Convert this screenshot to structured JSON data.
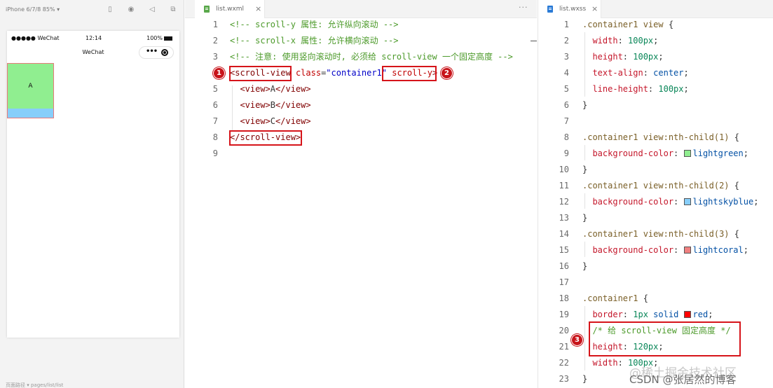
{
  "simulator": {
    "device_label": "iPhone 6/7/8 85% ▾",
    "status": {
      "carrier": "●●●●● WeChat",
      "time": "12:14",
      "battery": "100%"
    },
    "navbar_title": "WeChat",
    "views": [
      {
        "label": "A",
        "color": "#90ee90"
      },
      {
        "label": "",
        "color": "#87cefa"
      }
    ],
    "bottom_text": "页面路径 ▾    pages/list/list"
  },
  "wxml_editor": {
    "tab_label": "list.wxml",
    "lines": [
      {
        "n": "1",
        "tokens": [
          {
            "t": "<!-- scroll-y 属性: 允许纵向滚动 -->",
            "c": "comment"
          }
        ]
      },
      {
        "n": "2",
        "tokens": [
          {
            "t": "<!-- scroll-x 属性: 允许横向滚动 -->",
            "c": "comment"
          }
        ]
      },
      {
        "n": "3",
        "tokens": [
          {
            "t": "<!-- 注意: 使用竖向滚动时, 必须给 scroll-view 一个固定高度 -->",
            "c": "comment"
          }
        ]
      },
      {
        "n": "4",
        "tokens": [
          {
            "t": "<scroll-view",
            "c": "tag"
          },
          {
            "t": " ",
            "c": "punc"
          },
          {
            "t": "class",
            "c": "attr"
          },
          {
            "t": "=",
            "c": "punc"
          },
          {
            "t": "\"container1\"",
            "c": "str"
          },
          {
            "t": " ",
            "c": "punc"
          },
          {
            "t": "scroll-y",
            "c": "attr"
          },
          {
            "t": ">",
            "c": "tag"
          }
        ]
      },
      {
        "n": "5",
        "tokens": [
          {
            "t": "  <view>",
            "c": "tag"
          },
          {
            "t": "A",
            "c": "punc"
          },
          {
            "t": "</view>",
            "c": "tag"
          }
        ]
      },
      {
        "n": "6",
        "tokens": [
          {
            "t": "  <view>",
            "c": "tag"
          },
          {
            "t": "B",
            "c": "punc"
          },
          {
            "t": "</view>",
            "c": "tag"
          }
        ]
      },
      {
        "n": "7",
        "tokens": [
          {
            "t": "  <view>",
            "c": "tag"
          },
          {
            "t": "C",
            "c": "punc"
          },
          {
            "t": "</view>",
            "c": "tag"
          }
        ]
      },
      {
        "n": "8",
        "tokens": [
          {
            "t": "</scroll-view>",
            "c": "tag"
          }
        ]
      },
      {
        "n": "9",
        "tokens": []
      }
    ],
    "badges": [
      "1",
      "2"
    ]
  },
  "wxss_editor": {
    "tab_label": "list.wxss",
    "lines": [
      {
        "n": "1",
        "tokens": [
          {
            "t": ".container1 view",
            "c": "sel"
          },
          {
            "t": " {",
            "c": "punc"
          }
        ]
      },
      {
        "n": "2",
        "tokens": [
          {
            "t": "  width",
            "c": "prop"
          },
          {
            "t": ": ",
            "c": "punc"
          },
          {
            "t": "100px",
            "c": "num"
          },
          {
            "t": ";",
            "c": "punc"
          }
        ]
      },
      {
        "n": "3",
        "tokens": [
          {
            "t": "  height",
            "c": "prop"
          },
          {
            "t": ": ",
            "c": "punc"
          },
          {
            "t": "100px",
            "c": "num"
          },
          {
            "t": ";",
            "c": "punc"
          }
        ]
      },
      {
        "n": "4",
        "tokens": [
          {
            "t": "  text-align",
            "c": "prop"
          },
          {
            "t": ": ",
            "c": "punc"
          },
          {
            "t": "center",
            "c": "val"
          },
          {
            "t": ";",
            "c": "punc"
          }
        ]
      },
      {
        "n": "5",
        "tokens": [
          {
            "t": "  line-height",
            "c": "prop"
          },
          {
            "t": ": ",
            "c": "punc"
          },
          {
            "t": "100px",
            "c": "num"
          },
          {
            "t": ";",
            "c": "punc"
          }
        ]
      },
      {
        "n": "6",
        "tokens": [
          {
            "t": "}",
            "c": "punc"
          }
        ]
      },
      {
        "n": "7",
        "tokens": []
      },
      {
        "n": "8",
        "tokens": [
          {
            "t": ".container1 view:nth-child(1)",
            "c": "sel"
          },
          {
            "t": " {",
            "c": "punc"
          }
        ]
      },
      {
        "n": "9",
        "tokens": [
          {
            "t": "  background-color",
            "c": "prop"
          },
          {
            "t": ": ",
            "c": "punc"
          },
          {
            "t": "",
            "c": "swatch",
            "color": "#90ee90"
          },
          {
            "t": "lightgreen",
            "c": "val"
          },
          {
            "t": ";",
            "c": "punc"
          }
        ]
      },
      {
        "n": "10",
        "tokens": [
          {
            "t": "}",
            "c": "punc"
          }
        ]
      },
      {
        "n": "11",
        "tokens": [
          {
            "t": ".container1 view:nth-child(2)",
            "c": "sel"
          },
          {
            "t": " {",
            "c": "punc"
          }
        ]
      },
      {
        "n": "12",
        "tokens": [
          {
            "t": "  background-color",
            "c": "prop"
          },
          {
            "t": ": ",
            "c": "punc"
          },
          {
            "t": "",
            "c": "swatch",
            "color": "#87cefa"
          },
          {
            "t": "lightskyblue",
            "c": "val"
          },
          {
            "t": ";",
            "c": "punc"
          }
        ]
      },
      {
        "n": "13",
        "tokens": [
          {
            "t": "}",
            "c": "punc"
          }
        ]
      },
      {
        "n": "14",
        "tokens": [
          {
            "t": ".container1 view:nth-child(3)",
            "c": "sel"
          },
          {
            "t": " {",
            "c": "punc"
          }
        ]
      },
      {
        "n": "15",
        "tokens": [
          {
            "t": "  background-color",
            "c": "prop"
          },
          {
            "t": ": ",
            "c": "punc"
          },
          {
            "t": "",
            "c": "swatch",
            "color": "#f08080"
          },
          {
            "t": "lightcoral",
            "c": "val"
          },
          {
            "t": ";",
            "c": "punc"
          }
        ]
      },
      {
        "n": "16",
        "tokens": [
          {
            "t": "}",
            "c": "punc"
          }
        ]
      },
      {
        "n": "17",
        "tokens": []
      },
      {
        "n": "18",
        "tokens": [
          {
            "t": ".container1",
            "c": "sel"
          },
          {
            "t": " {",
            "c": "punc"
          }
        ]
      },
      {
        "n": "19",
        "tokens": [
          {
            "t": "  border",
            "c": "prop"
          },
          {
            "t": ": ",
            "c": "punc"
          },
          {
            "t": "1px",
            "c": "num"
          },
          {
            "t": " ",
            "c": "punc"
          },
          {
            "t": "solid",
            "c": "val"
          },
          {
            "t": " ",
            "c": "punc"
          },
          {
            "t": "",
            "c": "swatch",
            "color": "#ff0000"
          },
          {
            "t": "red",
            "c": "val"
          },
          {
            "t": ";",
            "c": "punc"
          }
        ]
      },
      {
        "n": "20",
        "tokens": [
          {
            "t": "  /* 给 scroll-view 固定高度 */",
            "c": "comment"
          }
        ]
      },
      {
        "n": "21",
        "tokens": [
          {
            "t": "  height",
            "c": "prop"
          },
          {
            "t": ": ",
            "c": "punc"
          },
          {
            "t": "120px",
            "c": "num"
          },
          {
            "t": ";",
            "c": "punc"
          }
        ]
      },
      {
        "n": "22",
        "tokens": [
          {
            "t": "  width",
            "c": "prop"
          },
          {
            "t": ": ",
            "c": "punc"
          },
          {
            "t": "100px",
            "c": "num"
          },
          {
            "t": ";",
            "c": "punc"
          }
        ]
      },
      {
        "n": "23",
        "tokens": [
          {
            "t": "}",
            "c": "punc"
          }
        ]
      }
    ],
    "badges": [
      "3"
    ]
  },
  "watermark": "@稀土掘金技术社区",
  "csdn_credit": "CSDN @张居然的博客",
  "colors": {
    "highlight_red": "#d6141a",
    "badge_red": "#c8141a"
  }
}
